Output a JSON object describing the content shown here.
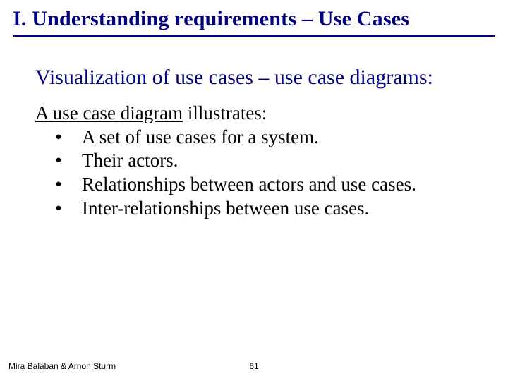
{
  "title": "I. Understanding requirements – Use Cases",
  "subtitle": "Visualization of use cases – use case diagrams:",
  "lead_underlined": "A use case diagram",
  "lead_rest": " illustrates:",
  "bullets": [
    "A set of use cases for a system.",
    "Their actors.",
    "Relationships between actors and use cases.",
    "Inter-relationships between use cases."
  ],
  "footer": {
    "authors": "Mira Balaban  &  Arnon Sturm",
    "page": "61"
  }
}
